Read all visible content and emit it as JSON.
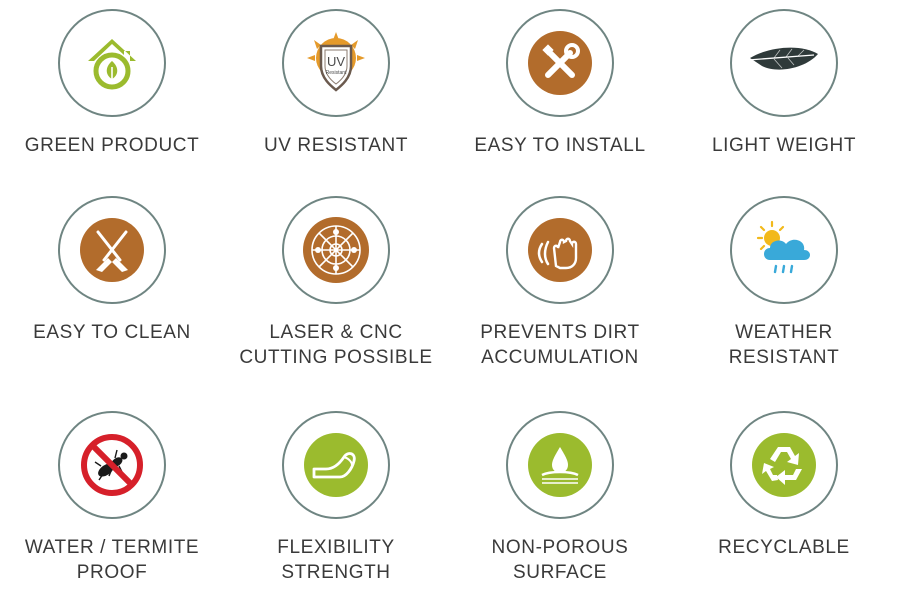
{
  "features": [
    {
      "icon": "green-home-leaf-icon",
      "lines": [
        "GREEN PRODUCT"
      ]
    },
    {
      "icon": "uv-shield-icon",
      "lines": [
        "UV RESISTANT"
      ],
      "icon_text": "UV",
      "icon_subtext": "Resistant"
    },
    {
      "icon": "wrench-screwdriver-icon",
      "lines": [
        "EASY TO INSTALL"
      ]
    },
    {
      "icon": "feather-icon",
      "lines": [
        "LIGHT WEIGHT"
      ]
    },
    {
      "icon": "broom-icon",
      "lines": [
        "EASY TO CLEAN"
      ]
    },
    {
      "icon": "ornamental-pattern-icon",
      "lines": [
        "LASER & CNC",
        "CUTTING POSSIBLE"
      ]
    },
    {
      "icon": "hand-wiping-icon",
      "lines": [
        "PREVENTS DIRT",
        "ACCUMULATION"
      ]
    },
    {
      "icon": "sun-cloud-rain-icon",
      "lines": [
        "WEATHER",
        "RESISTANT"
      ]
    },
    {
      "icon": "no-termite-icon",
      "lines": [
        "WATER / TERMITE",
        "PROOF"
      ]
    },
    {
      "icon": "flexible-sheet-icon",
      "lines": [
        "FLEXIBILITY",
        "STRENGTH"
      ]
    },
    {
      "icon": "water-drop-surface-icon",
      "lines": [
        "NON-POROUS",
        "SURFACE"
      ]
    },
    {
      "icon": "recycle-icon",
      "lines": [
        "RECYCLABLE"
      ]
    }
  ],
  "colors": {
    "ring": "#6f8582",
    "brown": "#b26c2c",
    "green": "#9bbb2e",
    "red": "#d6202a",
    "text": "#3a3a3a"
  }
}
